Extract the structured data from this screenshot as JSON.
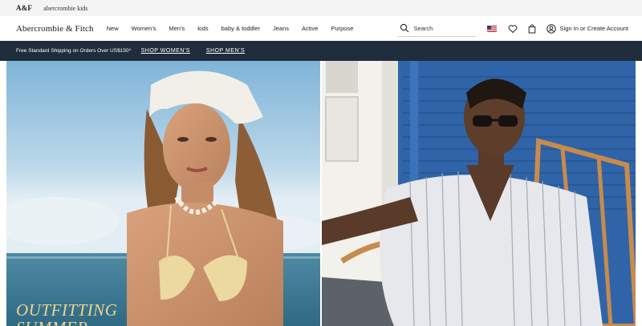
{
  "brand_strip": {
    "af": "A&F",
    "kids": "abercrombie kids"
  },
  "header": {
    "logo": "Abercrombie & Fitch",
    "nav": [
      "New",
      "Women's",
      "Men's",
      "kids",
      "baby & toddler",
      "Jeans",
      "Active",
      "Purpose"
    ],
    "search_placeholder": "Search",
    "account_label": "Sign In or Create Account"
  },
  "promo": {
    "text": "Free Standard Shipping on Orders Over US$150^",
    "links": [
      "SHOP WOMEN'S",
      "SHOP MEN'S"
    ]
  },
  "hero": {
    "headline_line1": "OUTFITTING",
    "headline_line2": "SUMMER"
  },
  "colors": {
    "promo_bg": "#1f2c3b",
    "strip_bg": "#f4f4f4",
    "headline": "#f1d28a",
    "flag_red": "#b22234",
    "flag_blue": "#3c3b6e"
  }
}
